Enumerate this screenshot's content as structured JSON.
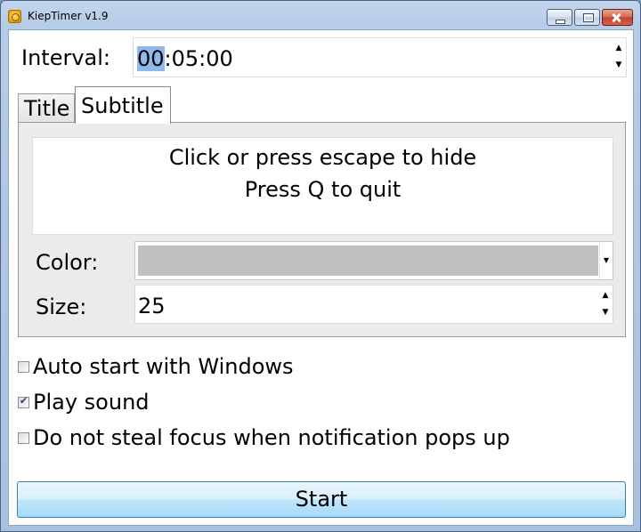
{
  "window": {
    "title": "KiepTimer v1.9",
    "icon": "timer-icon"
  },
  "interval": {
    "label": "Interval:",
    "value_highlighted": "00",
    "value_rest": ":05:00"
  },
  "tabs": [
    {
      "label": "Title",
      "selected": false
    },
    {
      "label": "Subtitle",
      "selected": true
    }
  ],
  "preview": {
    "line1": "Click or press escape to hide",
    "line2": "Press Q to quit"
  },
  "color": {
    "label": "Color:",
    "value": "#c0c0c0"
  },
  "size": {
    "label": "Size:",
    "value": "25"
  },
  "options": [
    {
      "label": "Auto start with Windows",
      "checked": false
    },
    {
      "label": "Play sound",
      "checked": true
    },
    {
      "label": "Do not steal focus when notification pops up",
      "checked": false
    }
  ],
  "start_button": "Start",
  "colors": {
    "selection_highlight": "#8fb8ec",
    "button_gradient_top": "#eaf6fd",
    "button_border": "#3c7fb1"
  }
}
